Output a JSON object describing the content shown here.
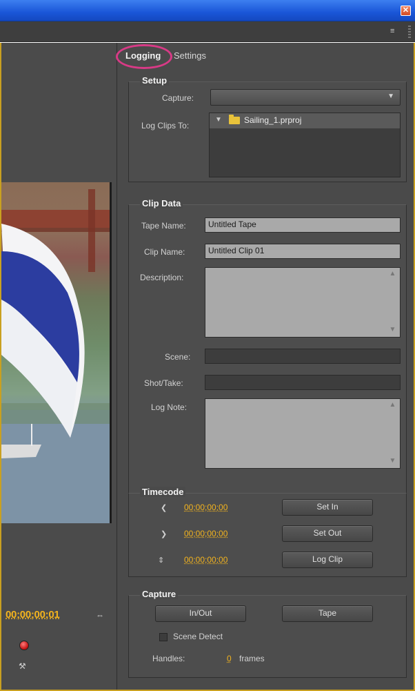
{
  "window": {
    "close_glyph": "✕"
  },
  "panel": {
    "menu_glyph": "≡"
  },
  "tabs": [
    {
      "label": "Logging",
      "active": true
    },
    {
      "label": "Settings",
      "active": false
    }
  ],
  "monitor": {
    "current_timecode": "00;00;00;01",
    "icons": [
      "fit-icon",
      "record-icon",
      "capture-settings-icon"
    ]
  },
  "setup": {
    "title": "Setup",
    "capture_label": "Capture:",
    "capture_value": "",
    "log_clips_to_label": "Log Clips To:",
    "project_file": "Sailing_1.prproj"
  },
  "clip_data": {
    "title": "Clip Data",
    "tape_name_label": "Tape Name:",
    "tape_name_value": "Untitled Tape",
    "clip_name_label": "Clip Name:",
    "clip_name_value": "Untitled Clip 01",
    "description_label": "Description:",
    "description_value": "",
    "scene_label": "Scene:",
    "scene_value": "",
    "shot_take_label": "Shot/Take:",
    "shot_take_value": "",
    "log_note_label": "Log Note:",
    "log_note_value": ""
  },
  "timecode": {
    "title": "Timecode",
    "in_value": "00;00;00;00",
    "out_value": "00;00;00;00",
    "duration_value": "00;00;00;00",
    "set_in_label": "Set In",
    "set_out_label": "Set Out",
    "log_clip_label": "Log Clip"
  },
  "capture": {
    "title": "Capture",
    "in_out_label": "In/Out",
    "tape_label": "Tape",
    "scene_detect_label": "Scene Detect",
    "scene_detect_checked": false,
    "handles_label": "Handles:",
    "handles_value": "0",
    "handles_unit": "frames"
  },
  "colors": {
    "timecode_accent": "#f2b31e",
    "tab_highlight": "#d83a86",
    "panel_border": "#c9a020"
  }
}
